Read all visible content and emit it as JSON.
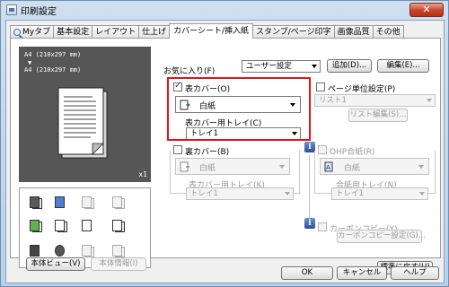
{
  "window": {
    "title": "印刷設定",
    "close_label": "✕"
  },
  "tabs": [
    {
      "label": "Myタブ"
    },
    {
      "label": "基本設定"
    },
    {
      "label": "レイアウト"
    },
    {
      "label": "仕上げ"
    },
    {
      "label": "カバーシート/挿入紙"
    },
    {
      "label": "スタンプ/ページ印字"
    },
    {
      "label": "画像品質"
    },
    {
      "label": "その他"
    }
  ],
  "preview": {
    "line1": "A4 (210x297 mm)",
    "line2": "▼",
    "line3": "A4 (210x297 mm)",
    "scale": "x1"
  },
  "left_buttons": {
    "view": "本体ビュー(V)",
    "info": "本体情報(I)"
  },
  "favorites": {
    "label": "お気に入り(F)",
    "value": "ユーザー設定",
    "add_label": "追加(D)...",
    "edit_label": "編集(E)..."
  },
  "front_cover": {
    "checkbox_label": "表カバー(O)",
    "checked": true,
    "paper": "白紙",
    "tray_label": "表カバー用トレイ(C)",
    "tray_value": "トレイ1"
  },
  "back_cover": {
    "checkbox_label": "裏カバー(B)",
    "checked": false,
    "paper": "白紙",
    "tray_label": "表カバー用トレイ(K)",
    "tray_value": "トレイ1"
  },
  "per_page": {
    "checkbox_label": "ページ単位設定(P)",
    "list_value": "リスト1",
    "edit_label": "リスト編集(S)..."
  },
  "ohp": {
    "checkbox_label": "OHP合紙(R)",
    "paper": "白紙",
    "tray_label": "合紙用トレイ(N)",
    "tray_value": "トレイ1"
  },
  "carbon": {
    "checkbox_label": "カーボンコピー(Y)",
    "settings_label": "カーボンコピー設定(G)..."
  },
  "reset_label": "標準に戻す(U)",
  "footer": {
    "ok": "OK",
    "cancel": "キャンセル",
    "help": "ヘルプ"
  },
  "colors": {
    "highlight": "#e0121a",
    "title_bar": "#b9d0ea"
  }
}
